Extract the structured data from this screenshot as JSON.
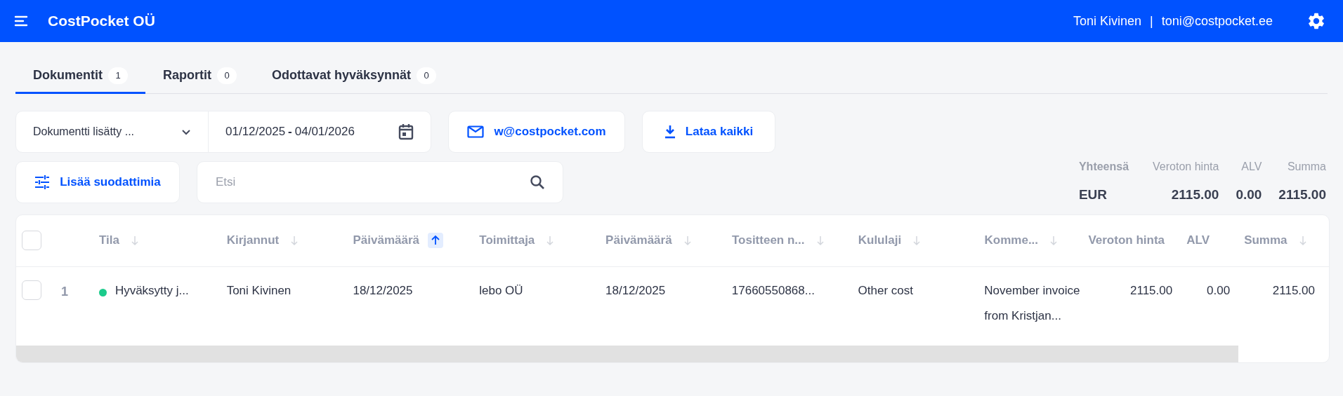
{
  "header": {
    "company": "CostPocket OÜ",
    "user_name": "Toni Kivinen",
    "separator": "|",
    "user_email": "toni@costpocket.ee"
  },
  "tabs": [
    {
      "label": "Dokumentit",
      "count": "1",
      "selected": true
    },
    {
      "label": "Raportit",
      "count": "0",
      "selected": false
    },
    {
      "label": "Odottavat hyväksynnät",
      "count": "0",
      "selected": false
    }
  ],
  "toolbar": {
    "date_filter": "Dokumentti lisätty ...",
    "date_range_start": "01/12/2025",
    "date_range_sep": "-",
    "date_range_end": "04/01/2026",
    "email_button": "w@costpocket.com",
    "download_button": "Lataa kaikki",
    "filters_button": "Lisää suodattimia",
    "search": {
      "placeholder": "Etsi"
    }
  },
  "totals": {
    "columns": [
      {
        "label": "Yhteensä",
        "value": "EUR"
      },
      {
        "label": "Veroton hinta",
        "value": "2115.00"
      },
      {
        "label": "ALV",
        "value": "0.00"
      },
      {
        "label": "Summa",
        "value": "2115.00"
      }
    ]
  },
  "table": {
    "select_all_checked": false,
    "columns": [
      {
        "label": "Tila",
        "sortable": true,
        "sorted": false
      },
      {
        "label": "Kirjannut",
        "sortable": true,
        "sorted": false
      },
      {
        "label": "Päivämäärä",
        "sortable": true,
        "sorted": true
      },
      {
        "label": "Toimittaja",
        "sortable": true,
        "sorted": false
      },
      {
        "label": "Päivämäärä",
        "sortable": true,
        "sorted": false
      },
      {
        "label": "Tositteen n...",
        "sortable": true,
        "sorted": false
      },
      {
        "label": "Kululaji",
        "sortable": true,
        "sorted": false
      },
      {
        "label": "Komme...",
        "sortable": true,
        "sorted": false
      },
      {
        "label": "Veroton hinta",
        "sortable": false
      },
      {
        "label": "ALV",
        "sortable": false
      },
      {
        "label": "Summa",
        "sortable": true,
        "sorted": false
      }
    ],
    "rows": [
      {
        "checked": false,
        "number": "1",
        "color": "#1ccb8c",
        "cells": [
          "Hyväksytty j...",
          "Toni Kivinen",
          "18/12/2025",
          "lebo OÜ",
          "18/12/2025",
          "17660550868...",
          "Other cost",
          "November invoice from Kristjan...",
          "2115.00",
          "0.00",
          "2115.00"
        ]
      }
    ]
  }
}
